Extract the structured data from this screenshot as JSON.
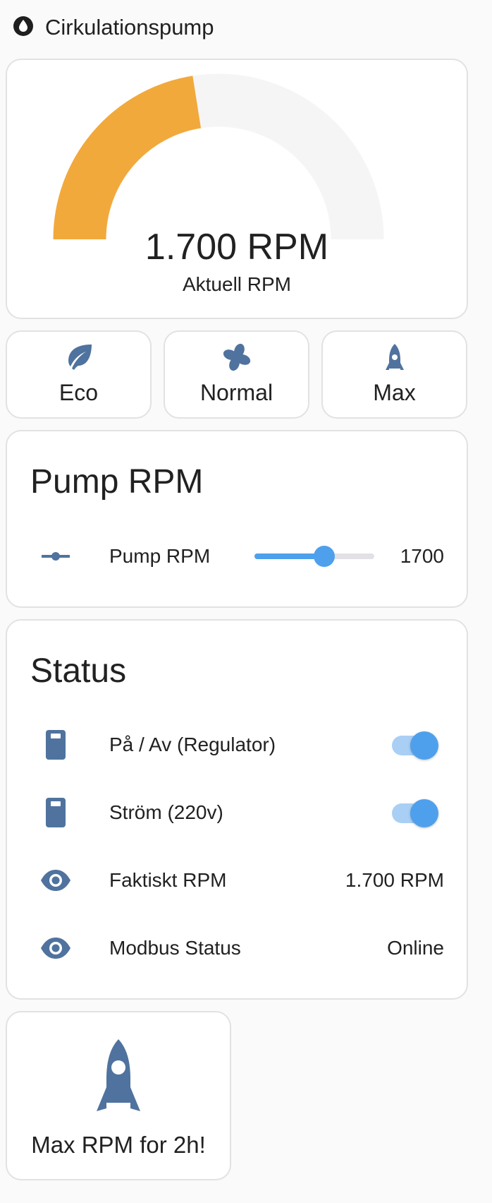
{
  "header": {
    "title": "Cirkulationspump",
    "icon": "water-drop-icon"
  },
  "gauge": {
    "value_text": "1.700 RPM",
    "label": "Aktuell RPM",
    "level_fraction": 0.45,
    "color_fill": "#f2a93b",
    "color_track": "#f5f5f5"
  },
  "modes": [
    {
      "label": "Eco",
      "icon": "leaf-icon"
    },
    {
      "label": "Normal",
      "icon": "fan-icon"
    },
    {
      "label": "Max",
      "icon": "rocket-icon"
    }
  ],
  "pump_rpm_card": {
    "title": "Pump RPM",
    "row_label": "Pump RPM",
    "value": "1700",
    "slider_fraction": 0.58,
    "icon": "slider-horizontal-icon"
  },
  "status_card": {
    "title": "Status",
    "rows": [
      {
        "label": "På / Av (Regulator)",
        "type": "toggle",
        "state": true,
        "icon": "power-socket-icon"
      },
      {
        "label": "Ström (220v)",
        "type": "toggle",
        "state": true,
        "icon": "power-socket-icon"
      },
      {
        "label": "Faktiskt RPM",
        "type": "value",
        "value": "1.700 RPM",
        "icon": "eye-icon"
      },
      {
        "label": "Modbus Status",
        "type": "value",
        "value": "Online",
        "icon": "eye-icon"
      }
    ]
  },
  "boost_button": {
    "label": "Max RPM for 2h!",
    "icon": "rocket-icon"
  },
  "colors": {
    "icon": "#4f739e",
    "accent": "#4fa0ec",
    "gauge": "#f2a93b"
  }
}
